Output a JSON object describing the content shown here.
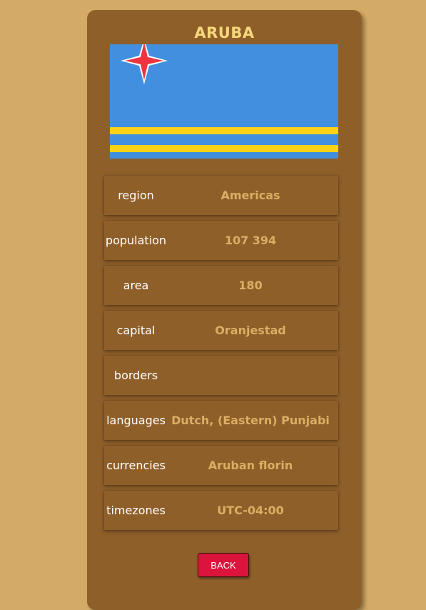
{
  "country": {
    "name": "ARUBA"
  },
  "flag": {
    "icon": "aruba-flag",
    "colors": {
      "field": "#418fde",
      "stripe": "#fcd116",
      "star": "#ef3340",
      "star_border": "#ffffff"
    }
  },
  "details": [
    {
      "label": "region",
      "value": "Americas"
    },
    {
      "label": "population",
      "value": "107 394"
    },
    {
      "label": "area",
      "value": "180"
    },
    {
      "label": "capital",
      "value": "Oranjestad"
    },
    {
      "label": "borders",
      "value": ""
    },
    {
      "label": "languages",
      "value": "Dutch, (Eastern) Punjabi"
    },
    {
      "label": "currencies",
      "value": "Aruban florin"
    },
    {
      "label": "timezones",
      "value": "UTC-04:00"
    }
  ],
  "back_button": {
    "label": "BACK"
  },
  "theme": {
    "page_background": "#d4ab66",
    "card_background": "#8f5f2a",
    "title_color": "#f6d77a",
    "value_color": "#dcae64",
    "button_color": "#dc143c"
  }
}
